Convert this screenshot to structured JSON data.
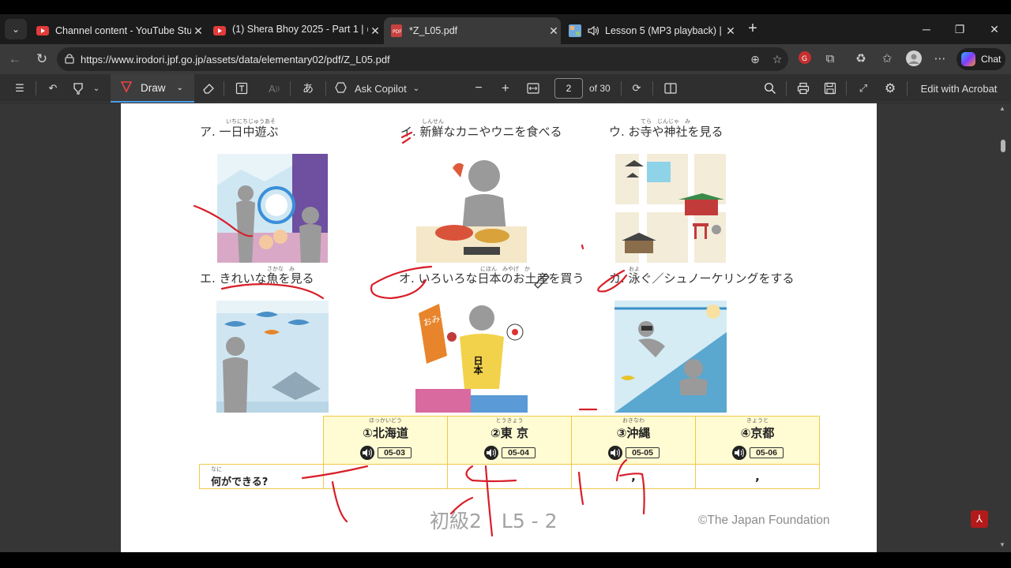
{
  "browser": {
    "tabs": [
      {
        "title": "Channel content - YouTube Studio",
        "icon": "youtube-icon",
        "active": false
      },
      {
        "title": "(1) Shera Bhoy 2025 - Part 1 | সেরা",
        "icon": "youtube-icon",
        "active": false
      },
      {
        "title": "*Z_L05.pdf",
        "icon": "pdf-icon",
        "active": true
      },
      {
        "title": "Lesson 5 (MP3 playback) | IRO",
        "icon": "irodori-icon",
        "active": false
      }
    ],
    "url": "https://www.irodori.jpf.go.jp/assets/data/elementary02/pdf/Z_L05.pdf",
    "chat_label": "Chat",
    "colors": {
      "accent": "#4a9ee8",
      "tab_active": "#3a3a3a",
      "tabstrip": "#1c1c1c"
    }
  },
  "pdf_toolbar": {
    "draw_label": "Draw",
    "ask_copilot_label": "Ask Copilot",
    "page_number": "2",
    "page_total": "of 30",
    "edit_label": "Edit with Acrobat"
  },
  "page": {
    "captions": [
      {
        "text": "ア. 一日中遊ぶ",
        "ruby": "いちにちじゅうあそ"
      },
      {
        "text": "イ. 新鮮なカニやウニを食べる",
        "ruby": "しんせん"
      },
      {
        "text": "ウ. お寺や神社を見る",
        "ruby": "てら　じんじゃ　み"
      },
      {
        "text": "エ. きれいな魚を見る",
        "ruby": "さかな　み"
      },
      {
        "text": "オ. いろいろな日本のお土産を買う",
        "ruby": "にほん　みやげ　か"
      },
      {
        "text": "カ. 泳ぐ／シュノーケリングをする",
        "ruby": "およ"
      }
    ],
    "illustration_t_shirt": "日本",
    "illustration_banner": "おみやげ",
    "table": {
      "row_label": "何ができる?",
      "row_label_ruby": "なに",
      "cities": [
        {
          "name": "①北海道",
          "ruby": "ほっかいどう",
          "audio": "05-03"
        },
        {
          "name": "②東 京",
          "ruby": "とうきょう",
          "audio": "05-04"
        },
        {
          "name": "③沖縄",
          "ruby": "おきなわ",
          "audio": "05-05"
        },
        {
          "name": "④京都",
          "ruby": "きょうと",
          "audio": "05-06"
        }
      ],
      "answers": [
        "",
        "",
        ",",
        ","
      ]
    },
    "footer_left": "初級2　L5 - 2",
    "footer_right": "©The Japan Foundation"
  }
}
